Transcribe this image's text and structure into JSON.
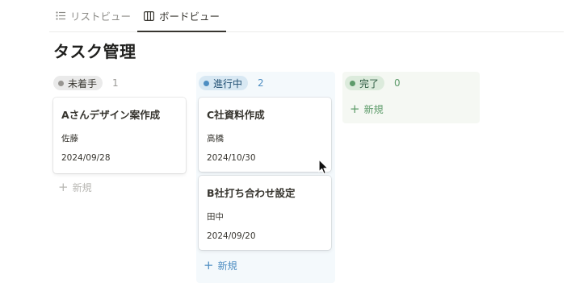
{
  "tabs": [
    {
      "label": "リストビュー",
      "icon": "list-icon",
      "active": false
    },
    {
      "label": "ボードビュー",
      "icon": "board-icon",
      "active": true
    }
  ],
  "page_title": "タスク管理",
  "columns": [
    {
      "status": "未着手",
      "count": "1",
      "color": "#979591",
      "new_label": "新規",
      "cards": [
        {
          "title": "Aさんデザイン案作成",
          "person": "佐藤",
          "date": "2024/09/28"
        }
      ]
    },
    {
      "status": "進行中",
      "count": "2",
      "color": "#4e8ec2",
      "new_label": "新規",
      "cards": [
        {
          "title": "C社資料作成",
          "person": "高橋",
          "date": "2024/10/30"
        },
        {
          "title": "B社打ち合わせ設定",
          "person": "田中",
          "date": "2024/09/20"
        }
      ]
    },
    {
      "status": "完了",
      "count": "0",
      "color": "#5d9b6a",
      "new_label": "新規",
      "cards": []
    }
  ]
}
